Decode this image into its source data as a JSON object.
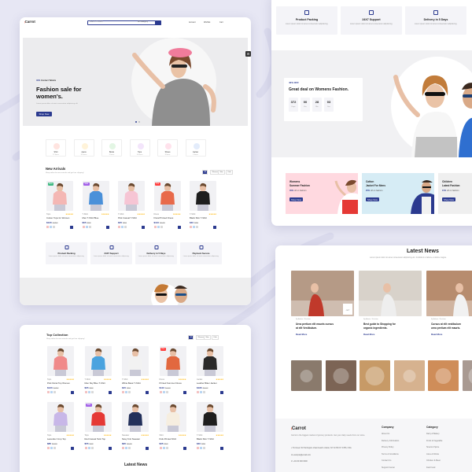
{
  "brand": {
    "logo": "Carrot",
    "accent": "#ff5a3c",
    "primary": "#2b3a8f"
  },
  "header": {
    "search_placeholder": "Search Product",
    "category_select": "All Category",
    "account": "Account",
    "wishlist": "Wishlist",
    "cart": "Cart"
  },
  "hero": {
    "eyebrow_pct": "40%",
    "eyebrow_text": "Contact Tablets",
    "title_line1": "Fashion sale for",
    "title_line2": "women's.",
    "desc": "Lorem ipsum dolor sit amet consectetur adipisicing elit.",
    "button": "Shop Now"
  },
  "categories": [
    {
      "label": "Shirt",
      "count": "12 Items",
      "color": "#ffe4e0"
    },
    {
      "label": "Jeans",
      "count": "10 Items",
      "color": "#fff3d9"
    },
    {
      "label": "Boots",
      "count": "9 Items",
      "color": "#e3f6e4"
    },
    {
      "label": "Tops",
      "count": "14 Items",
      "color": "#f3e5fb"
    },
    {
      "label": "Shoes",
      "count": "8 Items",
      "color": "#ffe2ec"
    },
    {
      "label": "Jacket",
      "count": "6 Items",
      "color": "#e3ecfb"
    }
  ],
  "new_arrivals": {
    "title": "New Arrivals",
    "subtitle": "Shop online for new arrivals and get free shipping!",
    "tabs": [
      "All",
      "Women",
      "Men",
      "Kids"
    ],
    "products": [
      {
        "badge": "New",
        "badge_color": "#3bb77e",
        "cat": "Tops",
        "name": "Cotton Tops for Women",
        "price": "$120",
        "old": "$150",
        "shirt": "#f4b7b4"
      },
      {
        "badge": "Sale",
        "badge_color": "#a15ee8",
        "cat": "T-Shirt",
        "name": "Men T-Shirt Blue",
        "price": "$65",
        "old": "$80",
        "shirt": "#4a90d9"
      },
      {
        "badge": "",
        "badge_color": "",
        "cat": "T-Shirt",
        "name": "Pink Casual T-Shirt",
        "price": "$45",
        "old": "$60",
        "shirt": "#f6c5d4"
      },
      {
        "badge": "Hot",
        "badge_color": "#ff3d3d",
        "cat": "Dress",
        "name": "Floral Printed Dress",
        "price": "$110",
        "old": "$140",
        "shirt": "#e86a4b"
      },
      {
        "badge": "",
        "badge_color": "",
        "cat": "T-Shirt",
        "name": "Black Slim T-Shirt",
        "price": "$40",
        "old": "$55",
        "shirt": "#1e1e1e"
      }
    ]
  },
  "features": [
    {
      "title": "Product Packing",
      "desc": "Lorem ipsum dolor sit amet consectetur adipisicing."
    },
    {
      "title": "24X7 Support",
      "desc": "Lorem ipsum dolor sit amet consectetur adipisicing."
    },
    {
      "title": "Delivery in 5 Days",
      "desc": "Lorem ipsum dolor sit amet consectetur adipisicing."
    },
    {
      "title": "Payment Secure",
      "desc": "Lorem ipsum dolor sit amet consectetur adipisicing."
    }
  ],
  "deal": {
    "pct": "40% OFF",
    "title": "Great deal on Womens Fashion.",
    "countdown": [
      {
        "value": "372",
        "unit": "Days"
      },
      {
        "value": "00",
        "unit": "Hrs"
      },
      {
        "value": "28",
        "unit": "Min"
      },
      {
        "value": "03",
        "unit": "Sec"
      }
    ]
  },
  "banners": [
    {
      "title_l1": "Womens",
      "title_l2": "Summer Fashion",
      "pct": "35%",
      "pct_text": "off on fashion",
      "button": "Shop Now",
      "bg": "#ffd9e0"
    },
    {
      "title_l1": "Cotton",
      "title_l2": "Jacket For Mens",
      "pct": "25%",
      "pct_text": "off on fashion",
      "button": "Shop Now",
      "bg": "#d6ecf5"
    },
    {
      "title_l1": "Children",
      "title_l2": "Latest Fashion",
      "pct": "15%",
      "pct_text": "off on fashion",
      "button": "Shop Now",
      "bg": "#efefef"
    }
  ],
  "news": {
    "title": "Latest News",
    "subtitle": "Lorem ipsum dolor sit amet consectetur adipisicing elit. Incididunt ut labore et dolore magna.",
    "posts": [
      {
        "meta": "By Admin / Fashion",
        "title_l1": "Urna pretium elit mauris cursus",
        "title_l2": "at elit Vestibulum.",
        "more": "Read More"
      },
      {
        "meta": "By Admin / Fashion",
        "title_l1": "Best guide to Shopping for",
        "title_l2": "organic ingredients.",
        "more": "Read More"
      },
      {
        "meta": "By Admin / Fashion",
        "title_l1": "Cursus at elit vestibulum",
        "title_l2": "urna pretium elit mauris.",
        "more": "Read More"
      }
    ],
    "countdown_label": "OCT"
  },
  "top_collection": {
    "title": "Top Collection",
    "subtitle": "Shop online for new arrivals and get free shipping!",
    "tabs": [
      "All",
      "Women",
      "Men",
      "Kids"
    ],
    "row1": [
      {
        "badge": "",
        "cat": "Tops",
        "name": "Pink Floral Top Women",
        "price": "$120",
        "old": "$150",
        "shirt": "#f08a8a"
      },
      {
        "badge": "",
        "cat": "T-Shirt",
        "name": "Men Sky Blue T-Shirt",
        "price": "$65",
        "old": "$80",
        "shirt": "#4aa3df"
      },
      {
        "badge": "",
        "cat": "T-Shirt",
        "name": "White Basic T-Shirt",
        "price": "$45",
        "old": "$60",
        "shirt": "#f2f2f2"
      },
      {
        "badge": "Hot",
        "cat": "Dress",
        "name": "Printed Summer Dress",
        "price": "$110",
        "old": "$140",
        "shirt": "#e2683f"
      },
      {
        "badge": "",
        "cat": "Jacket",
        "name": "Leather Biker Jacket",
        "price": "$180",
        "old": "$220",
        "shirt": "#2a2a2a"
      }
    ],
    "row2": [
      {
        "badge": "",
        "cat": "Tops",
        "name": "Lavender Crop Top",
        "price": "$85",
        "old": "$100",
        "shirt": "#c8b7e8"
      },
      {
        "badge": "Sale",
        "cat": "Tops",
        "name": "Red Casual Tank Top",
        "price": "$55",
        "old": "$70",
        "shirt": "#e53935"
      },
      {
        "badge": "",
        "cat": "Sweater",
        "name": "Navy Knit Sweater",
        "price": "$95",
        "old": "$120",
        "shirt": "#23305a"
      },
      {
        "badge": "",
        "cat": "Shirt",
        "name": "Kids Printed Shirt",
        "price": "$35",
        "old": "$50",
        "shirt": "#f6eee0"
      },
      {
        "badge": "",
        "cat": "T-Shirt",
        "name": "Black Slim T-Shirt",
        "price": "$40",
        "old": "$55",
        "shirt": "#1e1e1e"
      }
    ]
  },
  "footer": {
    "logo": "Carrot",
    "desc": "Carrot is the biggest market of grocery products. Get your daily needs from our store.",
    "address": "51 Green St.Huntington ohaio beach ontario, NY 11746 KY 4783, USA.",
    "email": "example@email.com",
    "phone": "+91 00 000 0000",
    "company_title": "Company",
    "company": [
      "About Us",
      "Delivery Information",
      "Privacy Policy",
      "Terms & Conditions",
      "Contact Us",
      "Support Center"
    ],
    "category_title": "Category",
    "category": [
      "Dairy & Bakery",
      "Fruits & Vegetable",
      "Snack & Spice",
      "Juice & Drinks",
      "Chicken & Meat",
      "Fast Food"
    ]
  },
  "bottom_news_title": "Latest News"
}
